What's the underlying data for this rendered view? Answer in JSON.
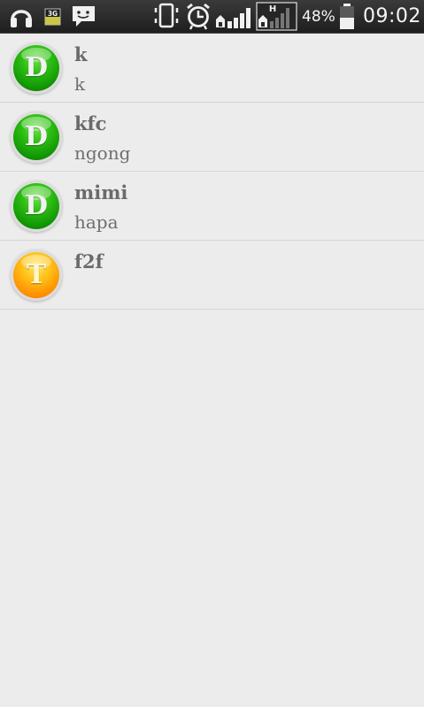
{
  "statusbar": {
    "icons": [
      "headphones-icon",
      "3g-icon",
      "message-icon",
      "vibrate-icon",
      "alarm-icon",
      "signal-icon",
      "h-data-icon",
      "battery-icon"
    ],
    "battery_percent": "48%",
    "time": "09:02",
    "network_badge": "3G",
    "data_badge": "H"
  },
  "colors": {
    "status_bar": "#2a2a2a",
    "background": "#ececec",
    "divider": "#d5d5d5",
    "text": "#6a6a6a",
    "avatar_green": "#1aa80a",
    "avatar_orange": "#ff9a00"
  },
  "contacts": [
    {
      "letter": "D",
      "color": "green",
      "name": "k",
      "subtitle": "k"
    },
    {
      "letter": "D",
      "color": "green",
      "name": "kfc",
      "subtitle": "ngong"
    },
    {
      "letter": "D",
      "color": "green",
      "name": "mimi",
      "subtitle": "hapa"
    },
    {
      "letter": "T",
      "color": "orange",
      "name": "f2f",
      "subtitle": ""
    }
  ]
}
